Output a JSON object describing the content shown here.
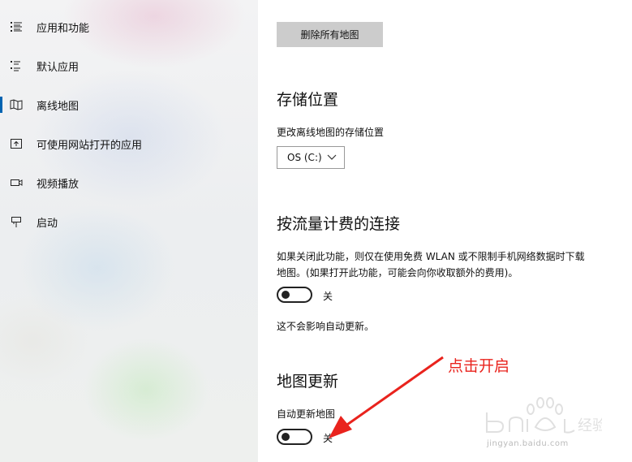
{
  "sidebar": {
    "items": [
      {
        "label": "应用和功能",
        "icon": "apps-features-icon",
        "active": false
      },
      {
        "label": "默认应用",
        "icon": "default-apps-icon",
        "active": false
      },
      {
        "label": "离线地图",
        "icon": "offline-maps-icon",
        "active": true
      },
      {
        "label": "可使用网站打开的应用",
        "icon": "apps-for-websites-icon",
        "active": false
      },
      {
        "label": "视频播放",
        "icon": "video-playback-icon",
        "active": false
      },
      {
        "label": "启动",
        "icon": "startup-icon",
        "active": false
      }
    ]
  },
  "main": {
    "delete_button": "删除所有地图",
    "storage": {
      "heading": "存储位置",
      "label": "更改离线地图的存储位置",
      "selected": "OS (C:)"
    },
    "metered": {
      "heading": "按流量计费的连接",
      "description_line1": "如果关闭此功能，则仅在使用免费 WLAN 或不限制手机网络数据时下载",
      "description_line2": "地图。(如果打开此功能，可能会向你收取额外的费用)。",
      "toggle_state": "关",
      "toggle_on": false,
      "note": "这不会影响自动更新。"
    },
    "updates": {
      "heading": "地图更新",
      "label": "自动更新地图",
      "toggle_state": "关",
      "toggle_on": false
    }
  },
  "annotation": {
    "text": "点击开启",
    "color": "#e9231d"
  },
  "watermark": {
    "text": "jingyan.baidu.com"
  },
  "colors": {
    "accent": "#0063b1",
    "button_bg": "#cccccc"
  }
}
